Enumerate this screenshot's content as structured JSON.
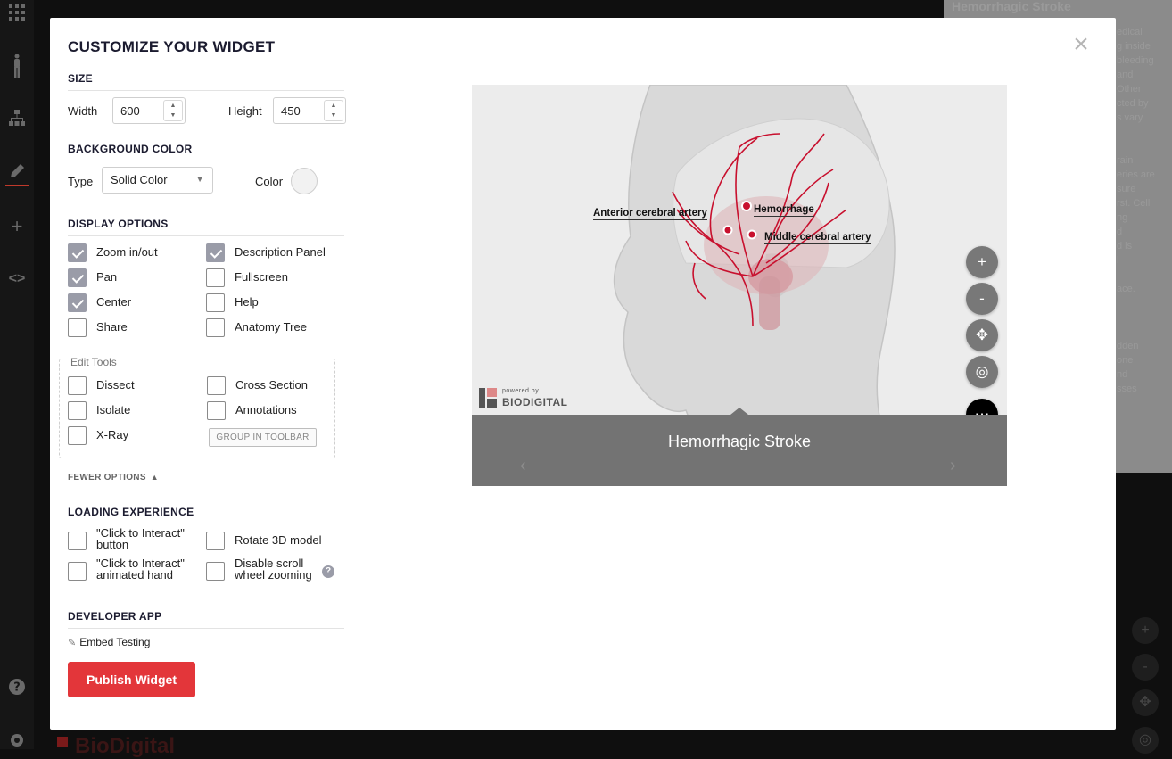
{
  "backdrop": {
    "title": "Hemorrhagic Stroke",
    "text": "edical\ng inside\nbleeding\nand\nOther\ncted by\ns vary\n\n\nrain\neries are\nsure\nrst. Cell\nng\nd\nd is\nl\n\nace.\n\n\n\ndden\n one\nnd\nsses\n\n\nn",
    "logo": "BioDigital"
  },
  "modal": {
    "title": "CUSTOMIZE YOUR WIDGET",
    "close": "×"
  },
  "size": {
    "heading": "SIZE",
    "width_label": "Width",
    "width_value": "600",
    "height_label": "Height",
    "height_value": "450"
  },
  "background": {
    "heading": "BACKGROUND COLOR",
    "type_label": "Type",
    "type_value": "Solid Color",
    "color_label": "Color",
    "swatch_color": "#f2f2f2"
  },
  "display": {
    "heading": "DISPLAY OPTIONS",
    "options": [
      {
        "label": "Zoom in/out",
        "checked": true
      },
      {
        "label": "Description Panel",
        "checked": true
      },
      {
        "label": "Pan",
        "checked": true
      },
      {
        "label": "Fullscreen",
        "checked": false
      },
      {
        "label": "Center",
        "checked": true
      },
      {
        "label": "Help",
        "checked": false
      },
      {
        "label": "Share",
        "checked": false
      },
      {
        "label": "Anatomy Tree",
        "checked": false
      }
    ]
  },
  "edit_tools": {
    "legend": "Edit Tools",
    "options": [
      {
        "label": "Dissect",
        "checked": false
      },
      {
        "label": "Cross Section",
        "checked": false
      },
      {
        "label": "Isolate",
        "checked": false
      },
      {
        "label": "Annotations",
        "checked": false
      },
      {
        "label": "X-Ray",
        "checked": false
      }
    ],
    "group_button": "GROUP IN TOOLBAR"
  },
  "fewer_options": "FEWER OPTIONS",
  "loading": {
    "heading": "LOADING EXPERIENCE",
    "options": [
      {
        "line1": "\"Click to Interact\"",
        "line2": "button",
        "checked": false
      },
      {
        "line1": "Rotate 3D model",
        "line2": "",
        "checked": false
      },
      {
        "line1": "\"Click to Interact\"",
        "line2": "animated hand",
        "checked": false
      },
      {
        "line1": "Disable scroll",
        "line2": "wheel zooming",
        "checked": false
      }
    ],
    "help_icon": "?"
  },
  "developer": {
    "heading": "DEVELOPER APP",
    "embed_link": "Embed Testing",
    "publish_button": "Publish Widget"
  },
  "preview": {
    "caption": "Hemorrhagic Stroke",
    "powered_small": "powered by",
    "powered_big": "BIODIGITAL",
    "annotations": {
      "a1": "Anterior cerebral artery",
      "a2": "Hemorrhage",
      "a3": "Middle cerebral artery"
    },
    "controls": {
      "zoom_in": "+",
      "zoom_out": "-",
      "pan": "✥",
      "center": "◎",
      "more": "⋯"
    },
    "prev": "‹",
    "next": "›"
  },
  "colors": {
    "accent": "#e3363a",
    "checkbox_checked": "#9a9ca8",
    "artery": "#c8102e"
  }
}
